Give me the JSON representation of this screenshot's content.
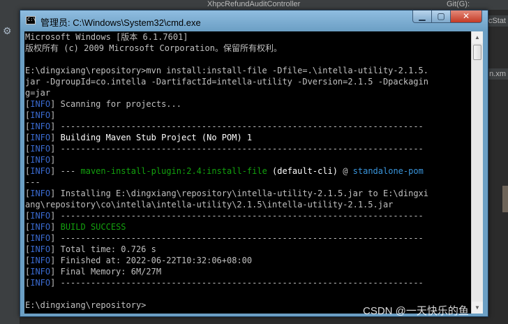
{
  "ide": {
    "toolbar_tab": "XhpcRefundAuditController",
    "git_label": "Git(G):",
    "right_tab_1": "cStat",
    "right_tab_2": "n.xm"
  },
  "window": {
    "title": "管理员: C:\\Windows\\System32\\cmd.exe",
    "icon_label": "C:\\",
    "minimize": "▁",
    "maximize": "▢",
    "close": "✕"
  },
  "console": {
    "lines": [
      [
        {
          "t": "Microsoft Windows [版本 6.1.7601]"
        }
      ],
      [
        {
          "t": "版权所有 (c) 2009 Microsoft Corporation。保留所有权利。"
        }
      ],
      [
        {
          "t": ""
        }
      ],
      [
        {
          "t": "E:\\dingxiang\\repository>mvn install:install-file -Dfile=.\\intella-utility-2.1.5."
        }
      ],
      [
        {
          "t": "jar -DgroupId=co.intella -DartifactId=intella-utility -Dversion=2.1.5 -Dpackagin"
        }
      ],
      [
        {
          "t": "g=jar"
        }
      ],
      [
        {
          "t": "["
        },
        {
          "t": "INFO",
          "c": "info"
        },
        {
          "t": "] Scanning for projects..."
        }
      ],
      [
        {
          "t": "["
        },
        {
          "t": "INFO",
          "c": "info"
        },
        {
          "t": "]"
        }
      ],
      [
        {
          "t": "["
        },
        {
          "t": "INFO",
          "c": "info"
        },
        {
          "t": "] ------------------------------------------------------------------------"
        }
      ],
      [
        {
          "t": "["
        },
        {
          "t": "INFO",
          "c": "info"
        },
        {
          "t": "] "
        },
        {
          "t": "Building Maven Stub Project (No POM) 1",
          "c": "white"
        }
      ],
      [
        {
          "t": "["
        },
        {
          "t": "INFO",
          "c": "info"
        },
        {
          "t": "] ------------------------------------------------------------------------"
        }
      ],
      [
        {
          "t": "["
        },
        {
          "t": "INFO",
          "c": "info"
        },
        {
          "t": "]"
        }
      ],
      [
        {
          "t": "["
        },
        {
          "t": "INFO",
          "c": "info"
        },
        {
          "t": "] --- "
        },
        {
          "t": "maven-install-plugin:2.4:install-file",
          "c": "green"
        },
        {
          "t": " (default-cli)",
          "c": "white"
        },
        {
          "t": " @ "
        },
        {
          "t": "standalone-pom",
          "c": "cyan"
        }
      ],
      [
        {
          "t": "---"
        }
      ],
      [
        {
          "t": "["
        },
        {
          "t": "INFO",
          "c": "info"
        },
        {
          "t": "] Installing E:\\dingxiang\\repository\\intella-utility-2.1.5.jar to E:\\dingxi"
        }
      ],
      [
        {
          "t": "ang\\repository\\co\\intella\\intella-utility\\2.1.5\\intella-utility-2.1.5.jar"
        }
      ],
      [
        {
          "t": "["
        },
        {
          "t": "INFO",
          "c": "info"
        },
        {
          "t": "] ------------------------------------------------------------------------"
        }
      ],
      [
        {
          "t": "["
        },
        {
          "t": "INFO",
          "c": "info"
        },
        {
          "t": "] "
        },
        {
          "t": "BUILD SUCCESS",
          "c": "green"
        }
      ],
      [
        {
          "t": "["
        },
        {
          "t": "INFO",
          "c": "info"
        },
        {
          "t": "] ------------------------------------------------------------------------"
        }
      ],
      [
        {
          "t": "["
        },
        {
          "t": "INFO",
          "c": "info"
        },
        {
          "t": "] Total time: 0.726 s"
        }
      ],
      [
        {
          "t": "["
        },
        {
          "t": "INFO",
          "c": "info"
        },
        {
          "t": "] Finished at: 2022-06-22T10:32:06+08:00"
        }
      ],
      [
        {
          "t": "["
        },
        {
          "t": "INFO",
          "c": "info"
        },
        {
          "t": "] Final Memory: 6M/27M"
        }
      ],
      [
        {
          "t": "["
        },
        {
          "t": "INFO",
          "c": "info"
        },
        {
          "t": "] ------------------------------------------------------------------------"
        }
      ],
      [
        {
          "t": ""
        }
      ],
      [
        {
          "t": "E:\\dingxiang\\repository>"
        }
      ]
    ]
  },
  "watermark": "CSDN @一天快乐的鱼"
}
